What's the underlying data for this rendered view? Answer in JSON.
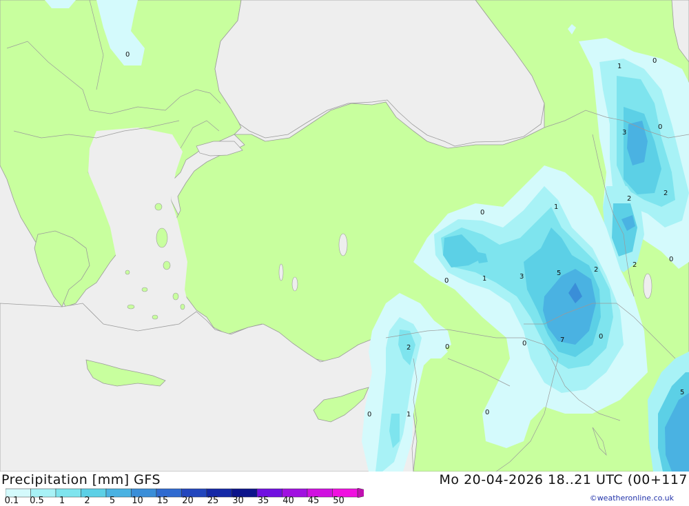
{
  "footer": {
    "title": "Precipitation [mm] GFS",
    "timestamp": "Mo 20-04-2026 18..21 UTC (00+117",
    "credit": "©weatheronline.co.uk"
  },
  "legend": {
    "ticks": [
      "0.1",
      "0.5",
      "1",
      "2",
      "5",
      "10",
      "15",
      "20",
      "25",
      "30",
      "35",
      "40",
      "45",
      "50"
    ],
    "colors": [
      "#d4fafc",
      "#a8f2f6",
      "#7ee4ee",
      "#5cd0e6",
      "#4ab2e2",
      "#3a8ed8",
      "#2f6ad0",
      "#2246bd",
      "#1428a6",
      "#0c148a",
      "#7010e0",
      "#a010e0",
      "#d010e0",
      "#f010e0",
      "#c010b0"
    ]
  },
  "map": {
    "land_color": "#c8ff9e",
    "sea_color": "#eeeeee",
    "value_labels": [
      {
        "id": "bulgaria-0",
        "text": "0"
      },
      {
        "id": "georgia-1",
        "text": "1"
      },
      {
        "id": "georgia-0a",
        "text": "0"
      },
      {
        "id": "georgia-3",
        "text": "3"
      },
      {
        "id": "georgia-0b",
        "text": "0"
      },
      {
        "id": "armenia-2a",
        "text": "2"
      },
      {
        "id": "armenia-2b",
        "text": "2"
      },
      {
        "id": "armenia-2c",
        "text": "2"
      },
      {
        "id": "armenia-0",
        "text": "0"
      },
      {
        "id": "east-anatolia-0",
        "text": "0"
      },
      {
        "id": "east-anatolia-1",
        "text": "1"
      },
      {
        "id": "east-anatolia-1b",
        "text": "1"
      },
      {
        "id": "east-anatolia-3",
        "text": "3"
      },
      {
        "id": "east-anatolia-5",
        "text": "5"
      },
      {
        "id": "east-anatolia-2",
        "text": "2"
      },
      {
        "id": "east-anatolia-0b",
        "text": "0"
      },
      {
        "id": "iraq-7",
        "text": "7"
      },
      {
        "id": "iraq-0",
        "text": "0"
      },
      {
        "id": "syria-0",
        "text": "0"
      },
      {
        "id": "levant-2",
        "text": "2"
      },
      {
        "id": "levant-0",
        "text": "0"
      },
      {
        "id": "lebanon-0",
        "text": "0"
      },
      {
        "id": "lebanon-1",
        "text": "1"
      },
      {
        "id": "jordan-0",
        "text": "0"
      },
      {
        "id": "iran-5",
        "text": "5"
      }
    ]
  }
}
